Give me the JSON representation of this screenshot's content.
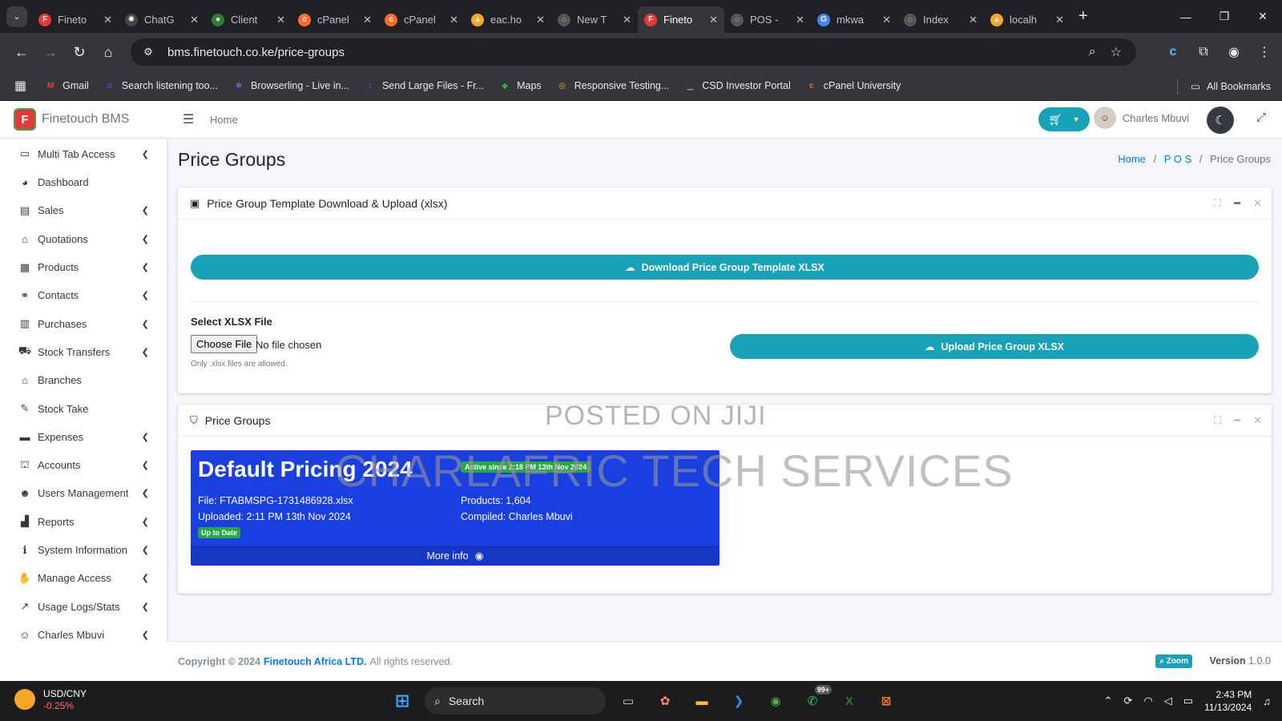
{
  "browser": {
    "tabs": [
      {
        "title": "Fineto",
        "color": "#e53935",
        "glyph": "F",
        "active": false
      },
      {
        "title": "ChatG",
        "color": "#444",
        "glyph": "✺",
        "active": false
      },
      {
        "title": "Client",
        "color": "#2e7d32",
        "glyph": "●",
        "active": false
      },
      {
        "title": "cPanel",
        "color": "#ff6c2c",
        "glyph": "c",
        "active": false
      },
      {
        "title": "cPanel",
        "color": "#ff6c2c",
        "glyph": "c",
        "active": false
      },
      {
        "title": "eac.ho",
        "color": "#f9a825",
        "glyph": "▲",
        "active": false
      },
      {
        "title": "New T",
        "color": "#555",
        "glyph": "◌",
        "active": false
      },
      {
        "title": "Fineto",
        "color": "#e53935",
        "glyph": "F",
        "active": true
      },
      {
        "title": "POS -",
        "color": "#555",
        "glyph": "◌",
        "active": false
      },
      {
        "title": "mkwa",
        "color": "#4285f4",
        "glyph": "G",
        "active": false
      },
      {
        "title": "Index",
        "color": "#555",
        "glyph": "◌",
        "active": false
      },
      {
        "title": "localh",
        "color": "#f9a825",
        "glyph": "▲",
        "active": false
      }
    ],
    "url": "bms.finetouch.co.ke/price-groups",
    "bookmarks": [
      {
        "label": "Gmail",
        "color": "#ea4335",
        "glyph": "M"
      },
      {
        "label": "Search listening too...",
        "color": "#3f51b5",
        "glyph": "≋"
      },
      {
        "label": "Browserling - Live in...",
        "color": "#5c6bc0",
        "glyph": "✱"
      },
      {
        "label": "Send Large Files - Fr...",
        "color": "#3949ab",
        "glyph": "t"
      },
      {
        "label": "Maps",
        "color": "#34a853",
        "glyph": "◆"
      },
      {
        "label": "Responsive Testing...",
        "color": "#f9a825",
        "glyph": "◎"
      },
      {
        "label": "CSD Investor Portal",
        "color": "#78909c",
        "glyph": "▁"
      },
      {
        "label": "cPanel University",
        "color": "#ff6c2c",
        "glyph": "c"
      }
    ],
    "all_bookmarks": "All Bookmarks"
  },
  "app": {
    "brand": "Finetouch BMS",
    "logo_letter": "F",
    "home": "Home",
    "user": "Charles Mbuvi",
    "page_title": "Price Groups",
    "breadcrumb": {
      "home": "Home",
      "pos": "P O S",
      "current": "Price Groups"
    },
    "sidebar": [
      {
        "label": "Multi Tab Access",
        "icon": "▭",
        "chevron": true
      },
      {
        "label": "Dashboard",
        "icon": "◕",
        "chevron": false
      },
      {
        "label": "Sales",
        "icon": "▤",
        "chevron": true
      },
      {
        "label": "Quotations",
        "icon": "⌂",
        "chevron": true
      },
      {
        "label": "Products",
        "icon": "▦",
        "chevron": true
      },
      {
        "label": "Contacts",
        "icon": "⚭",
        "chevron": true
      },
      {
        "label": "Purchases",
        "icon": "▥",
        "chevron": true
      },
      {
        "label": "Stock Transfers",
        "icon": "⛟",
        "chevron": true
      },
      {
        "label": "Branches",
        "icon": "⌂",
        "chevron": false
      },
      {
        "label": "Stock Take",
        "icon": "✎",
        "chevron": false
      },
      {
        "label": "Expenses",
        "icon": "▬",
        "chevron": true
      },
      {
        "label": "Accounts",
        "icon": "⛫",
        "chevron": true
      },
      {
        "label": "Users Management",
        "icon": "☻",
        "chevron": true
      },
      {
        "label": "Reports",
        "icon": "▟",
        "chevron": true
      },
      {
        "label": "System Information",
        "icon": "ℹ",
        "chevron": true
      },
      {
        "label": "Manage Access",
        "icon": "✋",
        "chevron": true
      },
      {
        "label": "Usage Logs/Stats",
        "icon": "↗",
        "chevron": true
      },
      {
        "label": "Charles Mbuvi",
        "icon": "☺",
        "chevron": true
      }
    ],
    "upload_card": {
      "title": "Price Group Template Download & Upload (xlsx)",
      "download_label": "Download Price Group Template XLSX",
      "select_label": "Select XLSX File",
      "choose_file": "Choose File",
      "no_file": "No file chosen",
      "help": "Only .xlsx files are allowed.",
      "upload_label": "Upload Price Group XLSX"
    },
    "groups_card": {
      "title": "Price Groups",
      "group": {
        "name": "Default Pricing 2024",
        "active_since": "Active since 2:18 PM 13th Nov 2024",
        "file": "File: FTABMSPG-1731486928.xlsx",
        "uploaded": "Uploaded: 2:11 PM 13th Nov 2024",
        "status": "Up to Date",
        "products": "Products: 1,604",
        "compiled": "Compiled: Charles Mbuvi",
        "more_info": "More info"
      }
    },
    "footer": {
      "copyright": "Copyright © 2024",
      "company": "Finetouch Africa LTD.",
      "rights": "All rights reserved.",
      "zoom": "Zoom",
      "version_label": "Version",
      "version": "1.0.0"
    }
  },
  "watermark": {
    "line1": "POSTED ON JIJI",
    "line2": "CHARLAFRIC TECH SERVICES"
  },
  "taskbar": {
    "ticker": "USD/CNY",
    "change": "-0.25%",
    "search": "Search",
    "badge": "99+",
    "time": "2:43 PM",
    "date": "11/13/2024"
  }
}
